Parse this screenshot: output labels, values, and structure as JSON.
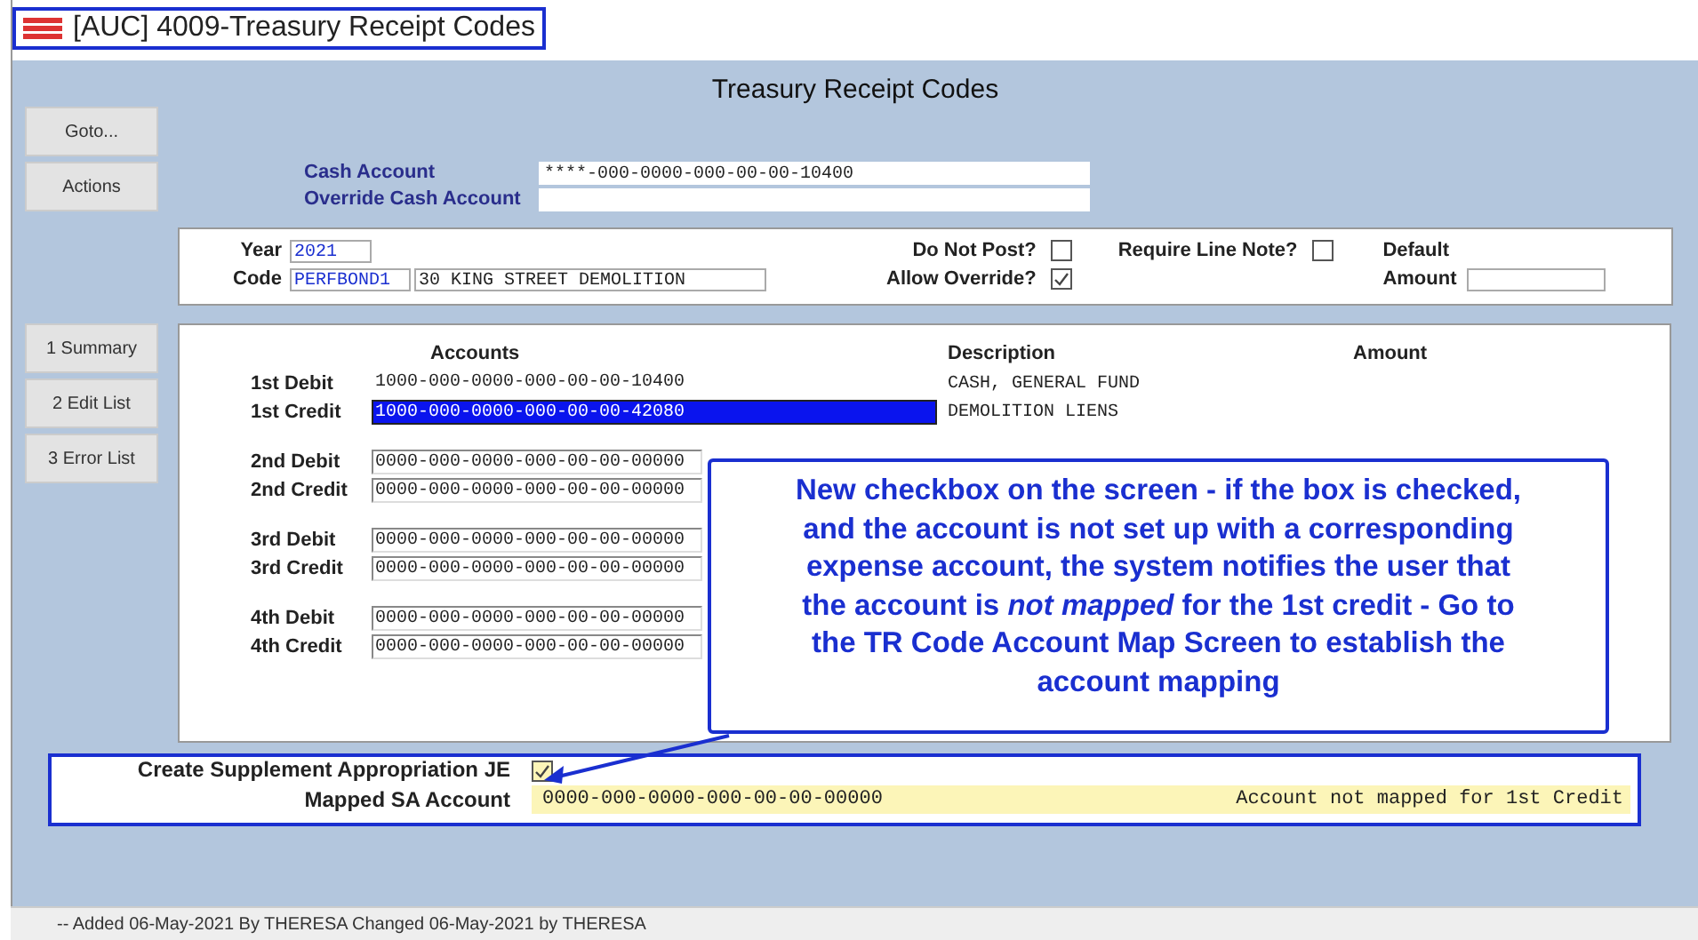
{
  "window": {
    "title": "[AUC] 4009-Treasury Receipt Codes"
  },
  "screen_title": "Treasury Receipt Codes",
  "side_buttons_top": [
    "Goto...",
    "Actions"
  ],
  "side_buttons_bottom": [
    "1 Summary",
    "2 Edit List",
    "3 Error List"
  ],
  "cash": {
    "cash_account_label": "Cash Account",
    "cash_account": "****-000-0000-000-00-00-10400",
    "override_label": "Override Cash Account"
  },
  "header": {
    "year_label": "Year",
    "year": "2021",
    "code_label": "Code",
    "code": "PERFBOND1",
    "code_description": "30 KING STREET DEMOLITION",
    "checks": [
      {
        "label": "Do Not Post?",
        "checked": false
      },
      {
        "label": "Require Line Note?",
        "checked": false
      },
      {
        "label": "Allow Override?",
        "checked": true
      }
    ],
    "default_label": "Default",
    "amount_label": "Amount"
  },
  "accounts": {
    "columns": [
      "Accounts",
      "Description",
      "Amount"
    ],
    "groups": [
      [
        {
          "label": "1st Debit",
          "kind": "text",
          "account": "1000-000-0000-000-00-00-10400",
          "description": "CASH, GENERAL FUND",
          "selected": false
        },
        {
          "label": "1st Credit",
          "kind": "field",
          "account": "1000-000-0000-000-00-00-42080",
          "description": "DEMOLITION LIENS",
          "selected": true
        }
      ],
      [
        {
          "label": "2nd Debit",
          "kind": "field",
          "account": "0000-000-0000-000-00-00-00000",
          "selected": false
        },
        {
          "label": "2nd Credit",
          "kind": "field",
          "account": "0000-000-0000-000-00-00-00000",
          "selected": false
        }
      ],
      [
        {
          "label": "3rd Debit",
          "kind": "field",
          "account": "0000-000-0000-000-00-00-00000",
          "selected": false
        },
        {
          "label": "3rd Credit",
          "kind": "field",
          "account": "0000-000-0000-000-00-00-00000",
          "selected": false
        }
      ],
      [
        {
          "label": "4th Debit",
          "kind": "field",
          "account": "0000-000-0000-000-00-00-00000",
          "selected": false
        },
        {
          "label": "4th Credit",
          "kind": "field",
          "account": "0000-000-0000-000-00-00-00000",
          "selected": false
        }
      ]
    ]
  },
  "callout": "New checkbox on the screen - if the box is checked, and the account is not set up with a corresponding expense account, the system notifies the user that the account is *not mapped* for the 1st credit - Go to the TR Code Account Map Screen to establish the account mapping",
  "supplement": {
    "label": "Create Supplement Appropriation JE",
    "checked": true,
    "mapped_label": "Mapped SA Account",
    "mapped_account": "0000-000-0000-000-00-00-00000",
    "mapped_message": "Account not mapped for 1st Credit"
  },
  "status_bar": "-- Added 06-May-2021 By THERESA Changed 06-May-2021 by THERESA"
}
